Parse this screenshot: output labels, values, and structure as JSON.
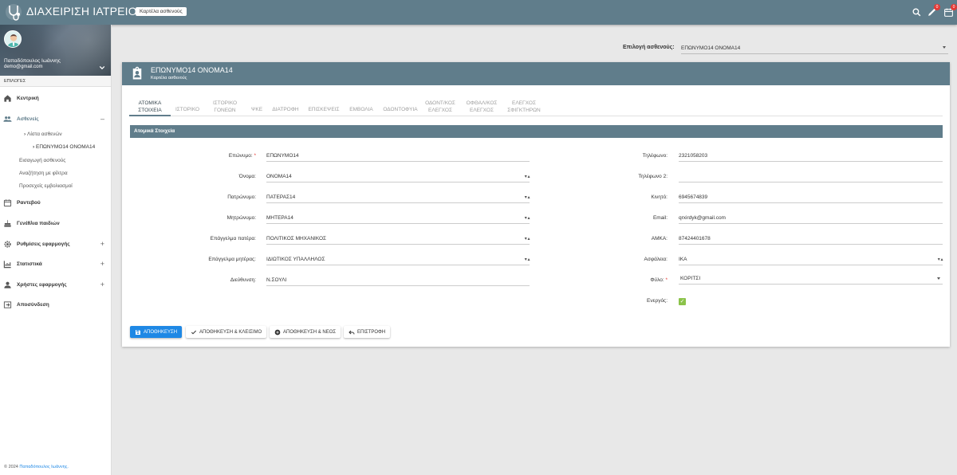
{
  "header": {
    "title": "ΔΙΑΧΕΙΡΙΣΗ ΙΑΤΡΕΙΟΥ",
    "chip": "Καρτέλα ασθενούς",
    "notifications_count": "0",
    "inbox_count": "0",
    "icons": [
      "search-icon",
      "rocket-icon",
      "calendar-icon"
    ]
  },
  "sidebar": {
    "user_name": "Παπαδόπουλος Ιωάννης",
    "user_email": "demo@gmail.com",
    "section_label": "ΕΠΙΛΟΓΕΣ",
    "items": [
      {
        "label": "Κεντρική",
        "icon": "home-icon"
      },
      {
        "label": "Ασθενείς",
        "icon": "people-icon",
        "toggle": "–"
      },
      {
        "label": "Ραντεβού",
        "icon": "calendar-icon"
      },
      {
        "label": "Γενέθλια παιδιών",
        "icon": "cake-icon"
      },
      {
        "label": "Ρυθμίσεις εφαρμογής",
        "icon": "gear-icon",
        "toggle": "+"
      },
      {
        "label": "Στατιστικά",
        "icon": "chart-icon",
        "toggle": "+"
      },
      {
        "label": "Χρήστες εφαρμογής",
        "icon": "person-icon",
        "toggle": "+"
      },
      {
        "label": "Αποσύνδεση",
        "icon": "logout-icon"
      }
    ],
    "patients_sub": [
      "Λίστα ασθενών",
      "ΕΠΩΝΥΜΟ14 ΟΝΟΜΑ14"
    ],
    "links": [
      "Εισαγωγή ασθενούς",
      "Αναζήτηση με φίλτρα",
      "Προσεχείς εμβολιασμοί"
    ],
    "footer_prefix": "© 2024",
    "footer_author": "Παπαδόπουλος Ιωάννης."
  },
  "patient_select": {
    "label": "Επιλογή ασθενούς:",
    "value": "ΕΠΩΝΥΜΟ14 ΟΝΟΜΑ14"
  },
  "card": {
    "title": "ΕΠΩΝΥΜΟ14 ΟΝΟΜΑ14",
    "subtitle": "Καρτέλα ασθενούς",
    "tabs": [
      {
        "line1": "ΑΤΟΜΙΚΑ",
        "line2": "ΣΤΟΙΧΕΙΑ"
      },
      {
        "line1": "ΙΣΤΟΡΙΚΟ",
        "line2": ""
      },
      {
        "line1": "ΙΣΤΟΡΙΚΟ",
        "line2": "ΓΟΝΕΩΝ"
      },
      {
        "line1": "ΨΚΕ",
        "line2": ""
      },
      {
        "line1": "ΔΙΑΤΡΟΦΗ",
        "line2": ""
      },
      {
        "line1": "ΕΠΙΣΚΕΨΕΙΣ",
        "line2": ""
      },
      {
        "line1": "ΕΜΒΟΛΙΑ",
        "line2": ""
      },
      {
        "line1": "ΟΔΟΝΤΟΦΥΙΑ",
        "line2": ""
      },
      {
        "line1": "ΟΔΟΝΤ/ΚΟΣ",
        "line2": "ΕΛΕΓΧΟΣ"
      },
      {
        "line1": "ΟΦΘΑΛ/ΚΟΣ",
        "line2": "ΕΛΕΓΧΟΣ"
      },
      {
        "line1": "ΕΛΕΓΧΟΣ",
        "line2": "ΣΦΙΓΚΤΗΡΩΝ"
      }
    ],
    "section_title": "Ατομικά Στοιχεία",
    "left_fields": [
      {
        "label": "Επώνυμο:",
        "value": "ΕΠΩΝΥΜΟ14",
        "required": "*"
      },
      {
        "label": "Όνομα:",
        "value": "ΟΝΟΜΑ14"
      },
      {
        "label": "Πατρώνυμο:",
        "value": "ΠΑΤΕΡΑΣ14"
      },
      {
        "label": "Μητρώνυμο:",
        "value": "ΜΗΤΕΡΑ14"
      },
      {
        "label": "Επάγγελμα πατέρα:",
        "value": "ΠΟΛΙΤΙΚΟΣ ΜΗΧΑΝΙΚΟΣ"
      },
      {
        "label": "Επάγγελμα μητέρας:",
        "value": "ΙΔΙΩΤΙΚΟΣ ΥΠΑΛΛΗΛΟΣ"
      },
      {
        "label": "Διεύθυνση:",
        "value": "Ν.ΣΟΥΛΙ"
      }
    ],
    "right_fields": [
      {
        "label": "Τηλέφωνο:",
        "value": "2321058203"
      },
      {
        "label": "Τηλέφωνο 2:",
        "value": ""
      },
      {
        "label": "Κινητό:",
        "value": "6945674839"
      },
      {
        "label": "Email:",
        "value": "qrxirdyk@gmail.com"
      },
      {
        "label": "ΑΜΚΑ:",
        "value": "87424401678"
      },
      {
        "label": "Ασφάλεια:",
        "value": "ΙΚΑ"
      },
      {
        "label": "Φύλο:",
        "value": "ΚΟΡΙΤΣΙ",
        "required": "*"
      },
      {
        "label": "Ενεργός:",
        "value": "✓"
      }
    ],
    "buttons": {
      "save": "ΑΠΟΘΗΚΕΥΣΗ",
      "save_close": "ΑΠΟΘΗΚΕΥΣΗ & ΚΛΕΙΣΙΜΟ",
      "save_new": "ΑΠΟΘΗΚΕΥΣΗ & ΝΕΟΣ",
      "back": "ΕΠΙΣΤΡΟΦΗ"
    }
  },
  "colors": {
    "primary": "#607d8b",
    "accent": "#1e88e5",
    "checkbox": "#8bc34a",
    "badge": "#e53935"
  }
}
